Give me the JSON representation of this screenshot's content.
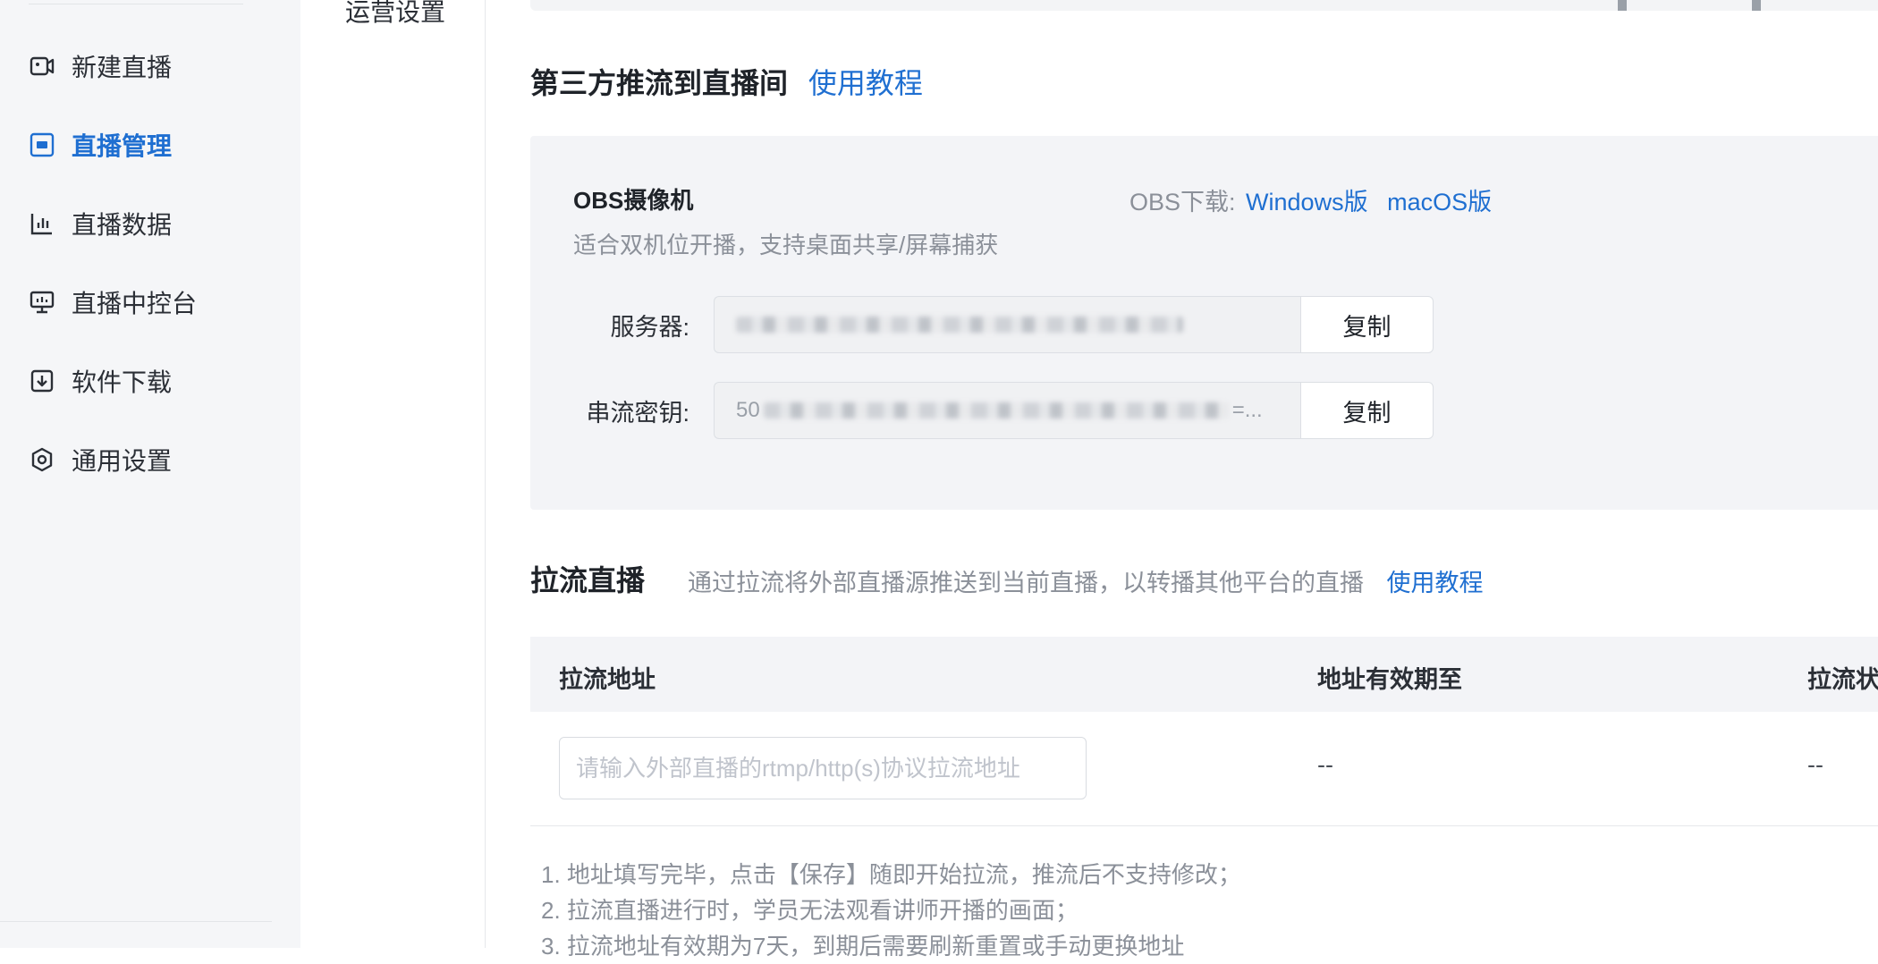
{
  "sidebar": {
    "items": [
      {
        "label": "新建直播",
        "icon": "video-camera-icon",
        "active": false
      },
      {
        "label": "直播管理",
        "icon": "monitor-icon",
        "active": true
      },
      {
        "label": "直播数据",
        "icon": "bar-chart-icon",
        "active": false
      },
      {
        "label": "直播中控台",
        "icon": "presentation-icon",
        "active": false
      },
      {
        "label": "软件下载",
        "icon": "download-icon",
        "active": false
      },
      {
        "label": "通用设置",
        "icon": "gear-icon",
        "active": false
      }
    ]
  },
  "subnav": {
    "current": "运营设置"
  },
  "third_party": {
    "title": "第三方推流到直播间",
    "tutorial_link": "使用教程",
    "obs": {
      "title": "OBS摄像机",
      "description": "适合双机位开播，支持桌面共享/屏幕捕获",
      "download_label": "OBS下载:",
      "windows_link": "Windows版",
      "macos_link": "macOS版"
    },
    "server": {
      "label": "服务器:",
      "copy_label": "复制"
    },
    "stream_key": {
      "label": "串流密钥:",
      "value_prefix": "50",
      "value_suffix": "=...",
      "copy_label": "复制"
    }
  },
  "pull_stream": {
    "title": "拉流直播",
    "description": "通过拉流将外部直播源推送到当前直播，以转播其他平台的直播",
    "tutorial_link": "使用教程",
    "columns": [
      "拉流地址",
      "地址有效期至",
      "拉流状"
    ],
    "row": {
      "url_placeholder": "请输入外部直播的rtmp/http(s)协议拉流地址",
      "expiry": "--",
      "status": "--"
    },
    "notes": [
      "1. 地址填写完毕，点击【保存】随即开始拉流，推流后不支持修改；",
      "2. 拉流直播进行时，学员无法观看讲师开播的画面；",
      "3. 拉流地址有效期为7天，到期后需要刷新重置或手动更换地址"
    ]
  },
  "colors": {
    "accent": "#1f6fd1",
    "sidebar_bg": "#f5f6f8",
    "panel_bg": "#f3f4f7",
    "muted_text": "#8b9099"
  }
}
